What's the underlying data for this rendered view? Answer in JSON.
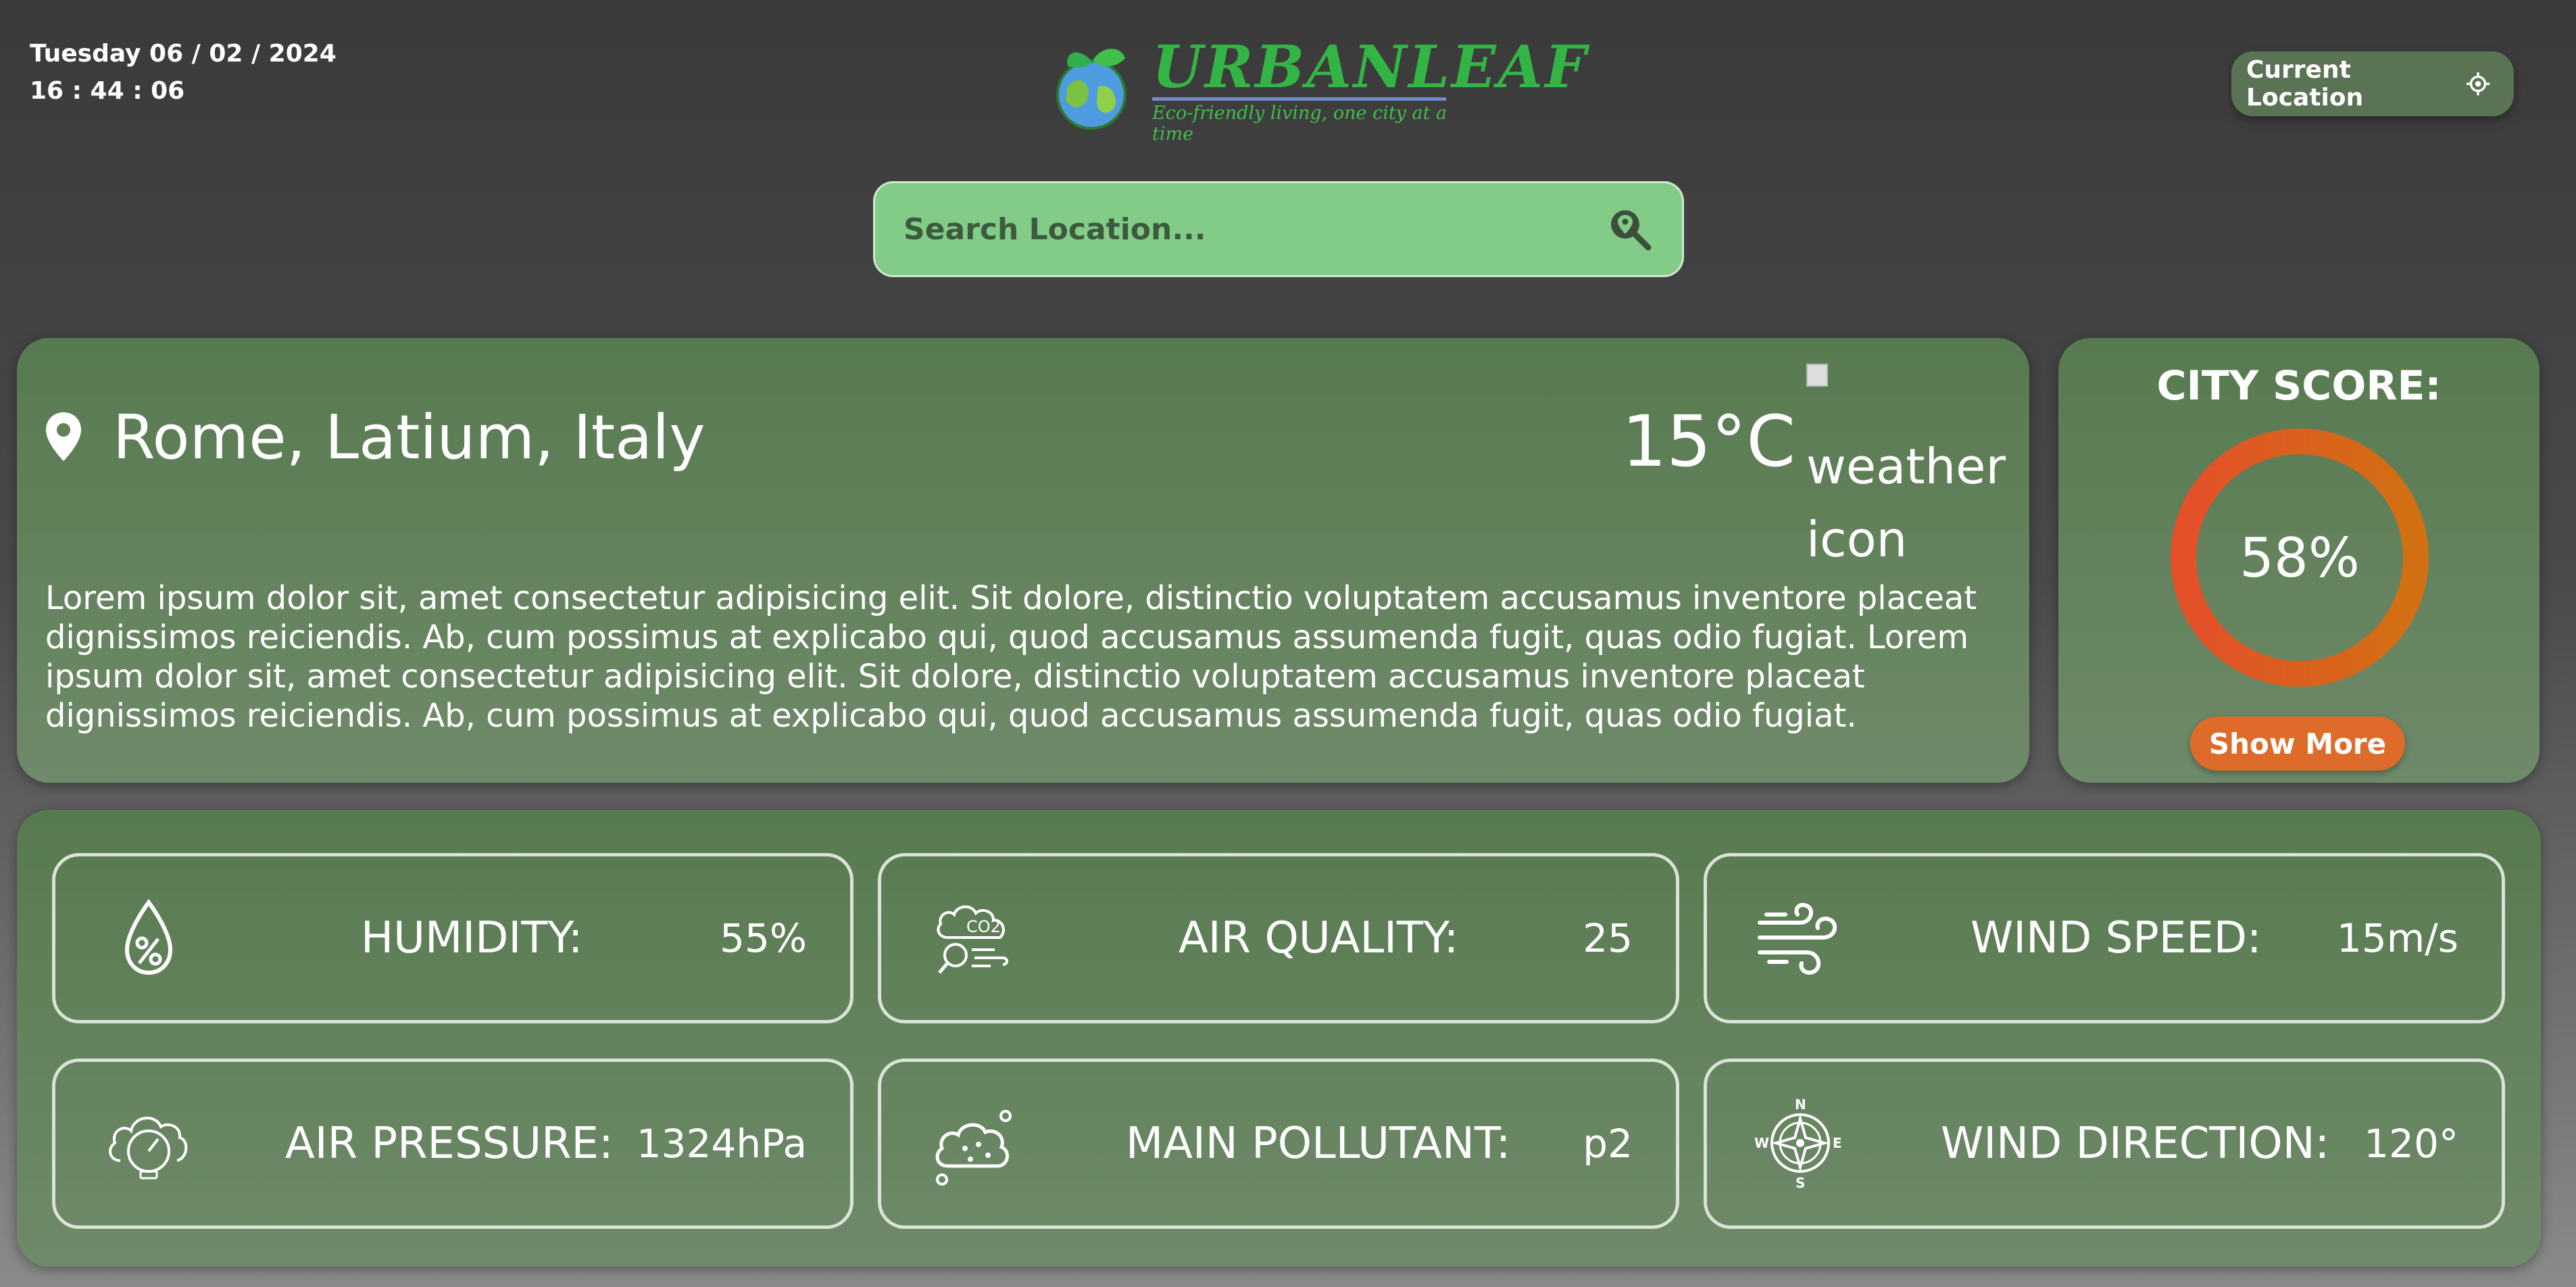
{
  "header": {
    "date": "Tuesday 06 / 02 / 2024",
    "time": "16 : 44 : 06",
    "brand": "URBANLEAF",
    "tagline": "Eco-friendly living, one city at a time",
    "current_location_label": "Current Location"
  },
  "search": {
    "placeholder": "Search Location..."
  },
  "city": {
    "name": "Rome, Latium, Italy",
    "temperature": "15°C",
    "weather_icon_alt": "weather icon",
    "description": "Lorem ipsum dolor sit, amet consectetur adipisicing elit. Sit dolore, distinctio voluptatem accusamus inventore placeat dignissimos reiciendis. Ab, cum possimus at explicabo qui, quod accusamus assumenda fugit, quas odio fugiat. Lorem ipsum dolor sit, amet consectetur adipisicing elit. Sit dolore, distinctio voluptatem accusamus inventore placeat dignissimos reiciendis. Ab, cum possimus at explicabo qui, quod accusamus assumenda fugit, quas odio fugiat."
  },
  "score": {
    "title": "CITY SCORE:",
    "value": "58%",
    "show_more_label": "Show More"
  },
  "stats": [
    {
      "label": "HUMIDITY:",
      "value": "55%",
      "icon": "humidity-drop-icon"
    },
    {
      "label": "AIR QUALITY:",
      "value": "25",
      "icon": "co2-cloud-icon"
    },
    {
      "label": "WIND SPEED:",
      "value": "15m/s",
      "icon": "wind-icon"
    },
    {
      "label": "AIR PRESSURE:",
      "value": "1324hPa",
      "icon": "pressure-gauge-icon"
    },
    {
      "label": "MAIN POLLUTANT:",
      "value": "p2",
      "icon": "pollutant-cloud-icon"
    },
    {
      "label": "WIND DIRECTION:",
      "value": "120°",
      "icon": "compass-icon"
    }
  ],
  "colors": {
    "accent_green": "#33b545",
    "search_bg": "#82cc88",
    "card_green": "#628059",
    "score_orange": "#df6b2a"
  }
}
